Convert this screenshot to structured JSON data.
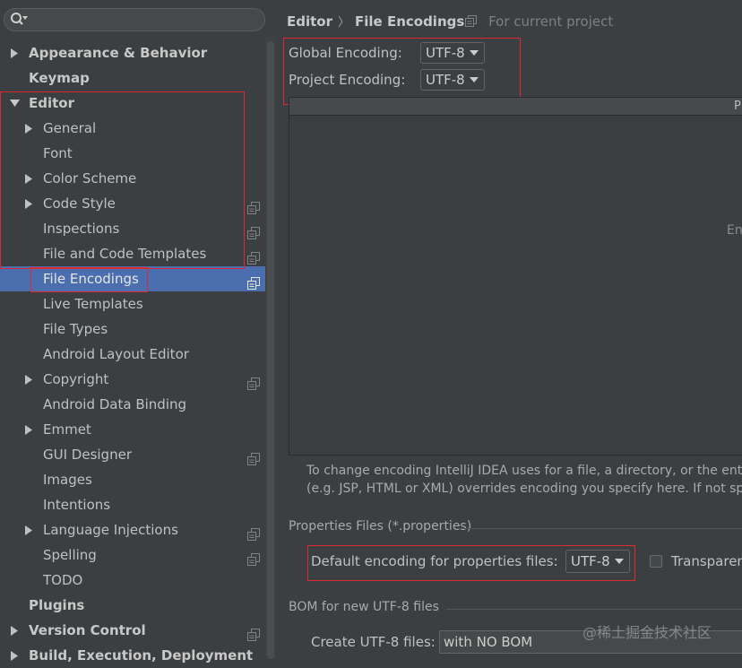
{
  "sidebar": {
    "search_placeholder": "",
    "items": [
      {
        "label": "Appearance & Behavior",
        "level": 0,
        "bold": true,
        "arrow": "right",
        "proj": false
      },
      {
        "label": "Keymap",
        "level": 0,
        "bold": true,
        "arrow": "none",
        "proj": false
      },
      {
        "label": "Editor",
        "level": 0,
        "bold": true,
        "arrow": "down",
        "proj": false
      },
      {
        "label": "General",
        "level": 1,
        "bold": false,
        "arrow": "right",
        "proj": false
      },
      {
        "label": "Font",
        "level": 1,
        "bold": false,
        "arrow": "none",
        "proj": false
      },
      {
        "label": "Color Scheme",
        "level": 1,
        "bold": false,
        "arrow": "right",
        "proj": false
      },
      {
        "label": "Code Style",
        "level": 1,
        "bold": false,
        "arrow": "right",
        "proj": true
      },
      {
        "label": "Inspections",
        "level": 1,
        "bold": false,
        "arrow": "none",
        "proj": true
      },
      {
        "label": "File and Code Templates",
        "level": 1,
        "bold": false,
        "arrow": "none",
        "proj": true
      },
      {
        "label": "File Encodings",
        "level": 1,
        "bold": false,
        "arrow": "none",
        "proj": true,
        "selected": true
      },
      {
        "label": "Live Templates",
        "level": 1,
        "bold": false,
        "arrow": "none",
        "proj": false
      },
      {
        "label": "File Types",
        "level": 1,
        "bold": false,
        "arrow": "none",
        "proj": false
      },
      {
        "label": "Android Layout Editor",
        "level": 1,
        "bold": false,
        "arrow": "none",
        "proj": false
      },
      {
        "label": "Copyright",
        "level": 1,
        "bold": false,
        "arrow": "right",
        "proj": true
      },
      {
        "label": "Android Data Binding",
        "level": 1,
        "bold": false,
        "arrow": "none",
        "proj": false
      },
      {
        "label": "Emmet",
        "level": 1,
        "bold": false,
        "arrow": "right",
        "proj": false
      },
      {
        "label": "GUI Designer",
        "level": 1,
        "bold": false,
        "arrow": "none",
        "proj": true
      },
      {
        "label": "Images",
        "level": 1,
        "bold": false,
        "arrow": "none",
        "proj": false
      },
      {
        "label": "Intentions",
        "level": 1,
        "bold": false,
        "arrow": "none",
        "proj": false
      },
      {
        "label": "Language Injections",
        "level": 1,
        "bold": false,
        "arrow": "right",
        "proj": true
      },
      {
        "label": "Spelling",
        "level": 1,
        "bold": false,
        "arrow": "none",
        "proj": true
      },
      {
        "label": "TODO",
        "level": 1,
        "bold": false,
        "arrow": "none",
        "proj": false
      },
      {
        "label": "Plugins",
        "level": 0,
        "bold": true,
        "arrow": "none",
        "proj": false
      },
      {
        "label": "Version Control",
        "level": 0,
        "bold": true,
        "arrow": "right",
        "proj": true
      },
      {
        "label": "Build, Execution, Deployment",
        "level": 0,
        "bold": true,
        "arrow": "right",
        "proj": false
      }
    ]
  },
  "breadcrumb": {
    "parent": "Editor",
    "separator": "〉",
    "current": "File Encodings",
    "scope": "For current project"
  },
  "encodings": {
    "global_label": "Global Encoding:",
    "global_value": "UTF-8",
    "project_label": "Project Encoding:",
    "project_value": "UTF-8"
  },
  "table": {
    "header": "P",
    "empty_text": "En"
  },
  "note": {
    "line1": "To change encoding IntelliJ IDEA uses for a file, a directory, or the entire",
    "line2": "(e.g. JSP, HTML or XML) overrides encoding you specify here. If not speci"
  },
  "properties": {
    "section_title": "Properties Files (*.properties)",
    "default_label": "Default encoding for properties files:",
    "default_value": "UTF-8",
    "transparent_label": "Transparen"
  },
  "bom": {
    "section_title": "BOM for new UTF-8 files",
    "create_label": "Create UTF-8 files:",
    "create_value": "with NO BOM"
  },
  "watermark": "@稀土掘金技术社区",
  "colors": {
    "background": "#3c3f41",
    "selection": "#4b6eaf",
    "highlight_box": "#e0282e"
  }
}
